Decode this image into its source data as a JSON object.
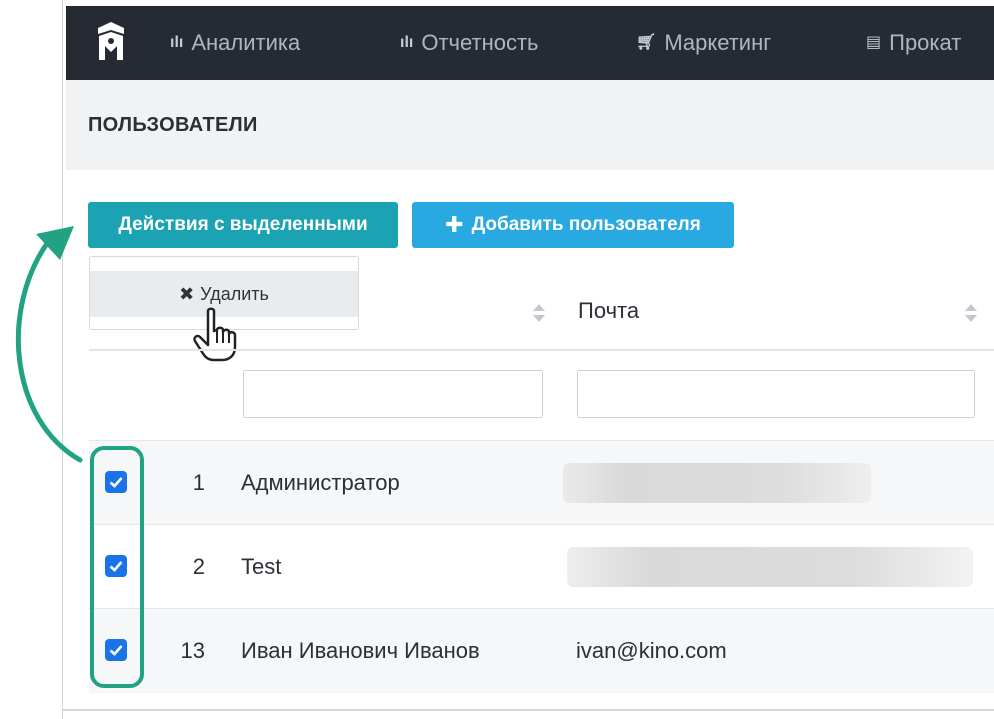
{
  "nav": {
    "items": [
      {
        "label": "Аналитика",
        "icon": "bar-chart-icon"
      },
      {
        "label": "Отчетность",
        "icon": "bar-chart-icon"
      },
      {
        "label": "Маркетинг",
        "icon": "shopping-cart-icon"
      },
      {
        "label": "Прокат",
        "icon": "film-icon"
      }
    ]
  },
  "page": {
    "title": "ПОЛЬЗОВАТЕЛИ"
  },
  "toolbar": {
    "actions_label": "Действия с выделенными",
    "add_user_label": "Добавить пользователя"
  },
  "dropdown": {
    "delete_label": "Удалить"
  },
  "table": {
    "columns": [
      "Почта"
    ],
    "rows": [
      {
        "id": "1",
        "name": "Администратор",
        "email": "",
        "checked": true
      },
      {
        "id": "2",
        "name": "Test",
        "email": "",
        "checked": true
      },
      {
        "id": "13",
        "name": "Иван Иванович Иванов",
        "email": "ivan@kino.com",
        "checked": true
      }
    ]
  },
  "colors": {
    "topbar": "#262a33",
    "actions_button": "#1ba2b3",
    "add_button": "#29a9e1",
    "checkbox": "#1a73e8",
    "annotation": "#20a283"
  }
}
